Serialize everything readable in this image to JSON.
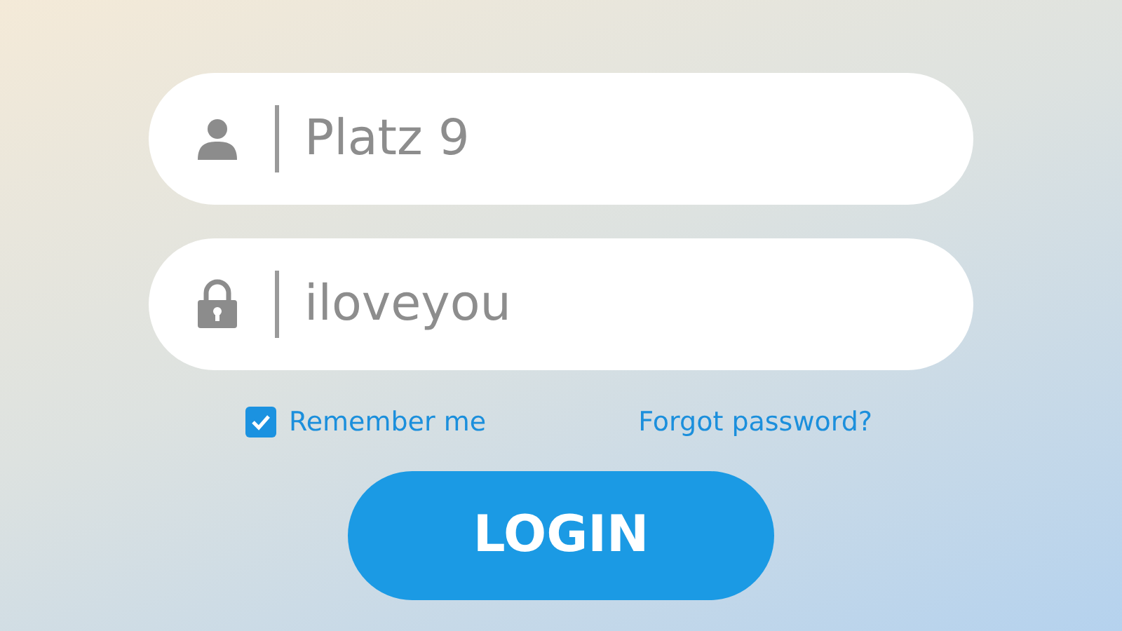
{
  "username_field": {
    "value": "Platz 9"
  },
  "password_field": {
    "value": "iloveyou"
  },
  "remember_me": {
    "label": "Remember me",
    "checked": true
  },
  "forgot_password": {
    "label": "Forgot password?"
  },
  "login_button": {
    "label": "LOGIN"
  }
}
